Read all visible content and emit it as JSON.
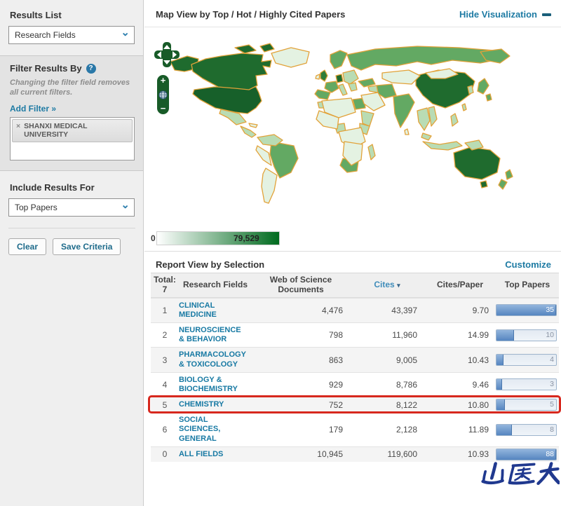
{
  "icons": {
    "chevron_down": "⌄",
    "remove": "×",
    "help": "?",
    "sort_desc": "▾"
  },
  "sidebar": {
    "results_list": {
      "label": "Results List",
      "selected": "Research Fields"
    },
    "filter": {
      "title": "Filter Results By",
      "note": "Changing the filter field removes all current filters.",
      "add_filter_label": "Add Filter »",
      "active_filters": [
        {
          "label": "SHANXI MEDICAL UNIVERSITY"
        }
      ]
    },
    "include_results": {
      "label": "Include Results For",
      "selected": "Top Papers"
    },
    "buttons": {
      "clear": "Clear",
      "save": "Save Criteria"
    }
  },
  "map_section": {
    "title": "Map View by Top / Hot / Highly Cited Papers",
    "hide_link": "Hide Visualization",
    "controls": {
      "zoom_in": "+",
      "zoom_out": "−"
    },
    "legend": {
      "min": "0",
      "max": "79,529",
      "min_color": "#ffffff",
      "max_color": "#006a1e"
    },
    "palette": {
      "border": "#e2a239",
      "darkest": "#17602a",
      "dark": "#1f6b2e",
      "medium_dark": "#2f7d3a",
      "medium": "#63a963",
      "light": "#b9dcb4",
      "pale": "#e4f2e2"
    }
  },
  "report": {
    "title": "Report View by Selection",
    "customize_link": "Customize",
    "total_label": "Total:",
    "total_value": "7",
    "columns": {
      "field": "Research Fields",
      "docs": "Web of Science Documents",
      "cites": "Cites",
      "cites_per_paper": "Cites/Paper",
      "top_papers": "Top Papers"
    },
    "sorted_column": "Cites",
    "highlight_color": "#d7281e",
    "rows": [
      {
        "rank": "1",
        "field": "CLINICAL MEDICINE",
        "docs": "4,476",
        "cites": "43,397",
        "cites_per_paper": "9.70",
        "top_papers": "35",
        "bar_pct": 100,
        "highlighted": false
      },
      {
        "rank": "2",
        "field": "NEUROSCIENCE & BEHAVIOR",
        "docs": "798",
        "cites": "11,960",
        "cites_per_paper": "14.99",
        "top_papers": "10",
        "bar_pct": 29,
        "highlighted": false
      },
      {
        "rank": "3",
        "field": "PHARMACOLOGY & TOXICOLOGY",
        "docs": "863",
        "cites": "9,005",
        "cites_per_paper": "10.43",
        "top_papers": "4",
        "bar_pct": 12,
        "highlighted": false
      },
      {
        "rank": "4",
        "field": "BIOLOGY & BIOCHEMISTRY",
        "docs": "929",
        "cites": "8,786",
        "cites_per_paper": "9.46",
        "top_papers": "3",
        "bar_pct": 9,
        "highlighted": false
      },
      {
        "rank": "5",
        "field": "CHEMISTRY",
        "docs": "752",
        "cites": "8,122",
        "cites_per_paper": "10.80",
        "top_papers": "5",
        "bar_pct": 14,
        "highlighted": true
      },
      {
        "rank": "6",
        "field": "SOCIAL SCIENCES, GENERAL",
        "docs": "179",
        "cites": "2,128",
        "cites_per_paper": "11.89",
        "top_papers": "8",
        "bar_pct": 26,
        "highlighted": false
      },
      {
        "rank": "0",
        "field": "ALL FIELDS",
        "docs": "10,945",
        "cites": "119,600",
        "cites_per_paper": "10.93",
        "top_papers": "88",
        "bar_pct": 100,
        "highlighted": false
      }
    ]
  },
  "watermark": {
    "text": "山医大",
    "color": "#20398f"
  }
}
